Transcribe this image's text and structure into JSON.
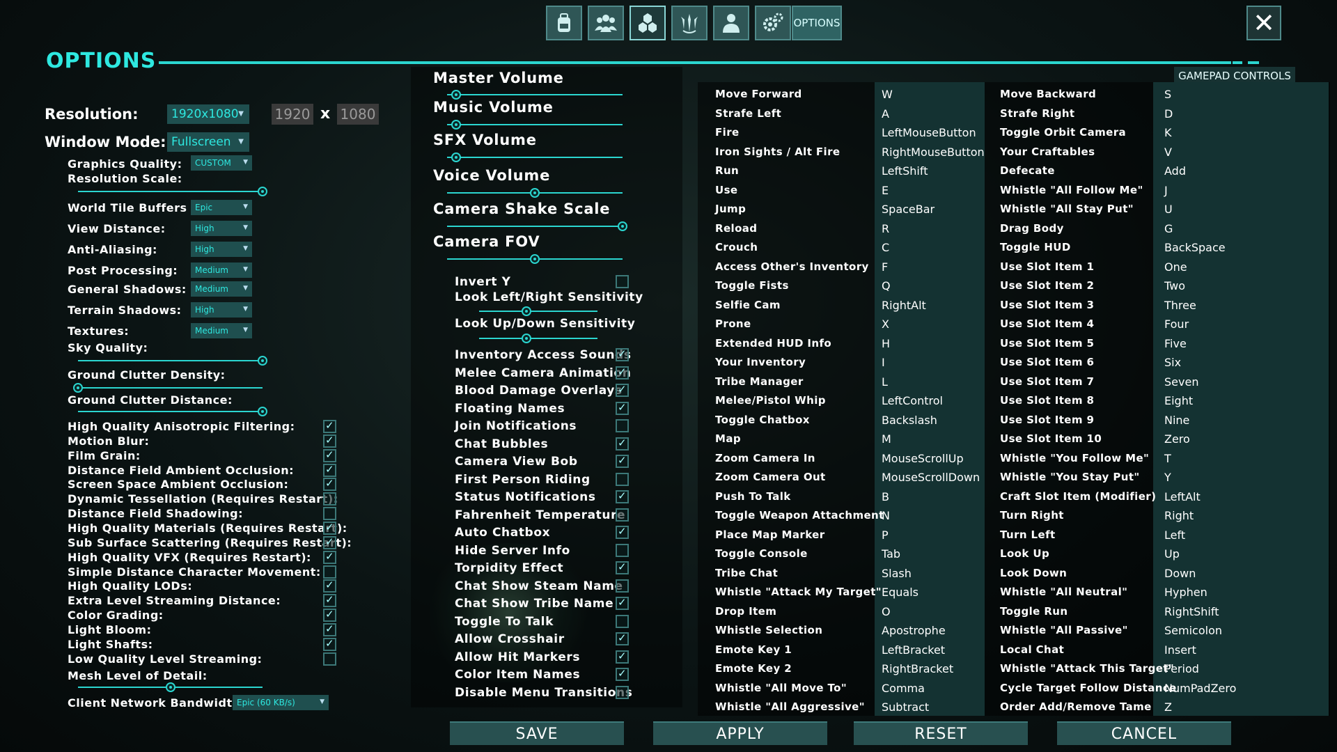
{
  "top_tabs": [
    {
      "name": "inventory-tab",
      "icon": "backpack-icon"
    },
    {
      "name": "tribe-tab",
      "icon": "group-icon"
    },
    {
      "name": "engrams-tab",
      "icon": "hexagons-icon"
    },
    {
      "name": "tame-tab",
      "icon": "claw-icon"
    },
    {
      "name": "character-tab",
      "icon": "person-icon"
    },
    {
      "name": "settings-tab",
      "icon": "gears-icon"
    }
  ],
  "options_tab_label": "OPTIONS",
  "close_label": "✕",
  "title": "OPTIONS",
  "gamepad_label": "GAMEPAD CONTROLS",
  "resolution": {
    "label": "Resolution:",
    "value": "1920x1080",
    "width": "1920",
    "x": "x",
    "height": "1080"
  },
  "window_mode": {
    "label": "Window Mode:",
    "value": "Fullscreen"
  },
  "graphics": {
    "quality_label": "Graphics Quality:",
    "quality_value": "CUSTOM",
    "res_scale_label": "Resolution Scale:",
    "world_tile_label": "World Tile Buffers",
    "world_tile_value": "Epic",
    "view_distance_label": "View Distance:",
    "view_distance_value": "High",
    "aa_label": "Anti-Aliasing:",
    "aa_value": "High",
    "post_label": "Post Processing:",
    "post_value": "Medium",
    "gen_shadows_label": "General Shadows:",
    "gen_shadows_value": "Medium",
    "terrain_shadows_label": "Terrain Shadows:",
    "terrain_shadows_value": "High",
    "textures_label": "Textures:",
    "textures_value": "Medium",
    "sky_label": "Sky Quality:",
    "clutter_density_label": "Ground Clutter Density:",
    "clutter_distance_label": "Ground Clutter Distance:",
    "mesh_lod_label": "Mesh Level of Detail:",
    "bandwidth_label": "Client Network Bandwidth:",
    "bandwidth_value": "Epic (60 KB/s)"
  },
  "gfx_checks": [
    {
      "label": "High Quality Anisotropic Filtering:",
      "checked": true
    },
    {
      "label": "Motion Blur:",
      "checked": true
    },
    {
      "label": "Film Grain:",
      "checked": true
    },
    {
      "label": "Distance Field Ambient Occlusion:",
      "checked": true
    },
    {
      "label": "Screen Space Ambient Occlusion:",
      "checked": true
    },
    {
      "label": "Dynamic Tessellation (Requires Restart):",
      "checked": false
    },
    {
      "label": "Distance Field Shadowing:",
      "checked": false
    },
    {
      "label": "High Quality Materials (Requires Restart):",
      "checked": true
    },
    {
      "label": "Sub Surface Scattering (Requires Restart):",
      "checked": true
    },
    {
      "label": "High Quality VFX (Requires Restart):",
      "checked": true
    },
    {
      "label": "Simple Distance Character Movement:",
      "checked": false
    },
    {
      "label": "High Quality LODs:",
      "checked": true
    },
    {
      "label": "Extra Level Streaming Distance:",
      "checked": true
    },
    {
      "label": "Color Grading:",
      "checked": true
    },
    {
      "label": "Light Bloom:",
      "checked": true
    },
    {
      "label": "Light Shafts:",
      "checked": true
    },
    {
      "label": "Low Quality Level Streaming:",
      "checked": false
    }
  ],
  "audio": {
    "master": "Master Volume",
    "music": "Music Volume",
    "sfx": "SFX Volume",
    "voice": "Voice Volume",
    "shake": "Camera Shake Scale",
    "fov": "Camera FOV",
    "invert_y": "Invert Y",
    "look_lr": "Look Left/Right Sensitivity",
    "look_ud": "Look Up/Down Sensitivity"
  },
  "mid_checks": [
    {
      "label": "Inventory Access Sounds",
      "checked": true
    },
    {
      "label": "Melee Camera Animation",
      "checked": true
    },
    {
      "label": "Blood Damage Overlays",
      "checked": true
    },
    {
      "label": "Floating Names",
      "checked": true
    },
    {
      "label": "Join Notifications",
      "checked": false
    },
    {
      "label": "Chat Bubbles",
      "checked": true
    },
    {
      "label": "Camera View Bob",
      "checked": true
    },
    {
      "label": "First Person Riding",
      "checked": false
    },
    {
      "label": "Status Notifications",
      "checked": true
    },
    {
      "label": "Fahrenheit Temperature",
      "checked": false
    },
    {
      "label": "Auto Chatbox",
      "checked": true
    },
    {
      "label": "Hide Server Info",
      "checked": false
    },
    {
      "label": "Torpidity Effect",
      "checked": true
    },
    {
      "label": "Chat Show Steam Name",
      "checked": false
    },
    {
      "label": "Chat Show Tribe Name",
      "checked": true
    },
    {
      "label": "Toggle To Talk",
      "checked": false
    },
    {
      "label": "Allow Crosshair",
      "checked": true
    },
    {
      "label": "Allow Hit Markers",
      "checked": true
    },
    {
      "label": "Color Item Names",
      "checked": true
    },
    {
      "label": "Disable Menu Transitions",
      "checked": false
    }
  ],
  "bindings_left": [
    [
      "Move Forward",
      "W"
    ],
    [
      "Strafe Left",
      "A"
    ],
    [
      "Fire",
      "LeftMouseButton"
    ],
    [
      "Iron Sights / Alt Fire",
      "RightMouseButton"
    ],
    [
      "Run",
      "LeftShift"
    ],
    [
      "Use",
      "E"
    ],
    [
      "Jump",
      "SpaceBar"
    ],
    [
      "Reload",
      "R"
    ],
    [
      "Crouch",
      "C"
    ],
    [
      "Access Other's Inventory",
      "F"
    ],
    [
      "Toggle Fists",
      "Q"
    ],
    [
      "Selfie Cam",
      "RightAlt"
    ],
    [
      "Prone",
      "X"
    ],
    [
      "Extended HUD Info",
      "H"
    ],
    [
      "Your Inventory",
      "I"
    ],
    [
      "Tribe Manager",
      "L"
    ],
    [
      "Melee/Pistol Whip",
      "LeftControl"
    ],
    [
      "Toggle Chatbox",
      "Backslash"
    ],
    [
      "Map",
      "M"
    ],
    [
      "Zoom Camera In",
      "MouseScrollUp"
    ],
    [
      "Zoom Camera Out",
      "MouseScrollDown"
    ],
    [
      "Push To Talk",
      "B"
    ],
    [
      "Toggle Weapon Attachment",
      "N"
    ],
    [
      "Place Map Marker",
      "P"
    ],
    [
      "Toggle Console",
      "Tab"
    ],
    [
      "Tribe Chat",
      "Slash"
    ],
    [
      "Whistle \"Attack My Target\"",
      "Equals"
    ],
    [
      "Drop Item",
      "O"
    ],
    [
      "Whistle Selection",
      "Apostrophe"
    ],
    [
      "Emote Key 1",
      "LeftBracket"
    ],
    [
      "Emote Key 2",
      "RightBracket"
    ],
    [
      "Whistle \"All Move To\"",
      "Comma"
    ],
    [
      "Whistle \"All Aggressive\"",
      "Subtract"
    ]
  ],
  "bindings_right": [
    [
      "Move Backward",
      "S"
    ],
    [
      "Strafe Right",
      "D"
    ],
    [
      "Toggle Orbit Camera",
      "K"
    ],
    [
      "Your Craftables",
      "V"
    ],
    [
      "Defecate",
      "Add"
    ],
    [
      "Whistle \"All Follow Me\"",
      "J"
    ],
    [
      "Whistle \"All Stay Put\"",
      "U"
    ],
    [
      "Drag Body",
      "G"
    ],
    [
      "Toggle HUD",
      "BackSpace"
    ],
    [
      "Use Slot Item 1",
      "One"
    ],
    [
      "Use Slot Item 2",
      "Two"
    ],
    [
      "Use Slot Item 3",
      "Three"
    ],
    [
      "Use Slot Item 4",
      "Four"
    ],
    [
      "Use Slot Item 5",
      "Five"
    ],
    [
      "Use Slot Item 6",
      "Six"
    ],
    [
      "Use Slot Item 7",
      "Seven"
    ],
    [
      "Use Slot Item 8",
      "Eight"
    ],
    [
      "Use Slot Item 9",
      "Nine"
    ],
    [
      "Use Slot Item 10",
      "Zero"
    ],
    [
      "Whistle \"You Follow Me\"",
      "T"
    ],
    [
      "Whistle \"You Stay Put\"",
      "Y"
    ],
    [
      "Craft Slot Item (Modifier)",
      "LeftAlt"
    ],
    [
      "Turn Right",
      "Right"
    ],
    [
      "Turn Left",
      "Left"
    ],
    [
      "Look Up",
      "Up"
    ],
    [
      "Look Down",
      "Down"
    ],
    [
      "Whistle \"All Neutral\"",
      "Hyphen"
    ],
    [
      "Toggle Run",
      "RightShift"
    ],
    [
      "Whistle \"All Passive\"",
      "Semicolon"
    ],
    [
      "Local Chat",
      "Insert"
    ],
    [
      "Whistle \"Attack This Target\"",
      "Period"
    ],
    [
      "Cycle Target Follow Distance",
      "NumPadZero"
    ],
    [
      "Order Add/Remove Tame",
      "Z"
    ]
  ],
  "slider_values": {
    "res_scale": 1.0,
    "sky": 1.0,
    "clutter_density": 0.0,
    "clutter_distance": 1.0,
    "mesh_lod": 0.5,
    "master": 0.05,
    "music": 0.05,
    "sfx": 0.05,
    "voice": 0.5,
    "shake": 1.0,
    "fov": 0.5,
    "look_lr": 0.4,
    "look_ud": 0.4
  },
  "buttons": {
    "save": "SAVE",
    "apply": "APPLY",
    "reset": "RESET",
    "cancel": "CANCEL"
  }
}
